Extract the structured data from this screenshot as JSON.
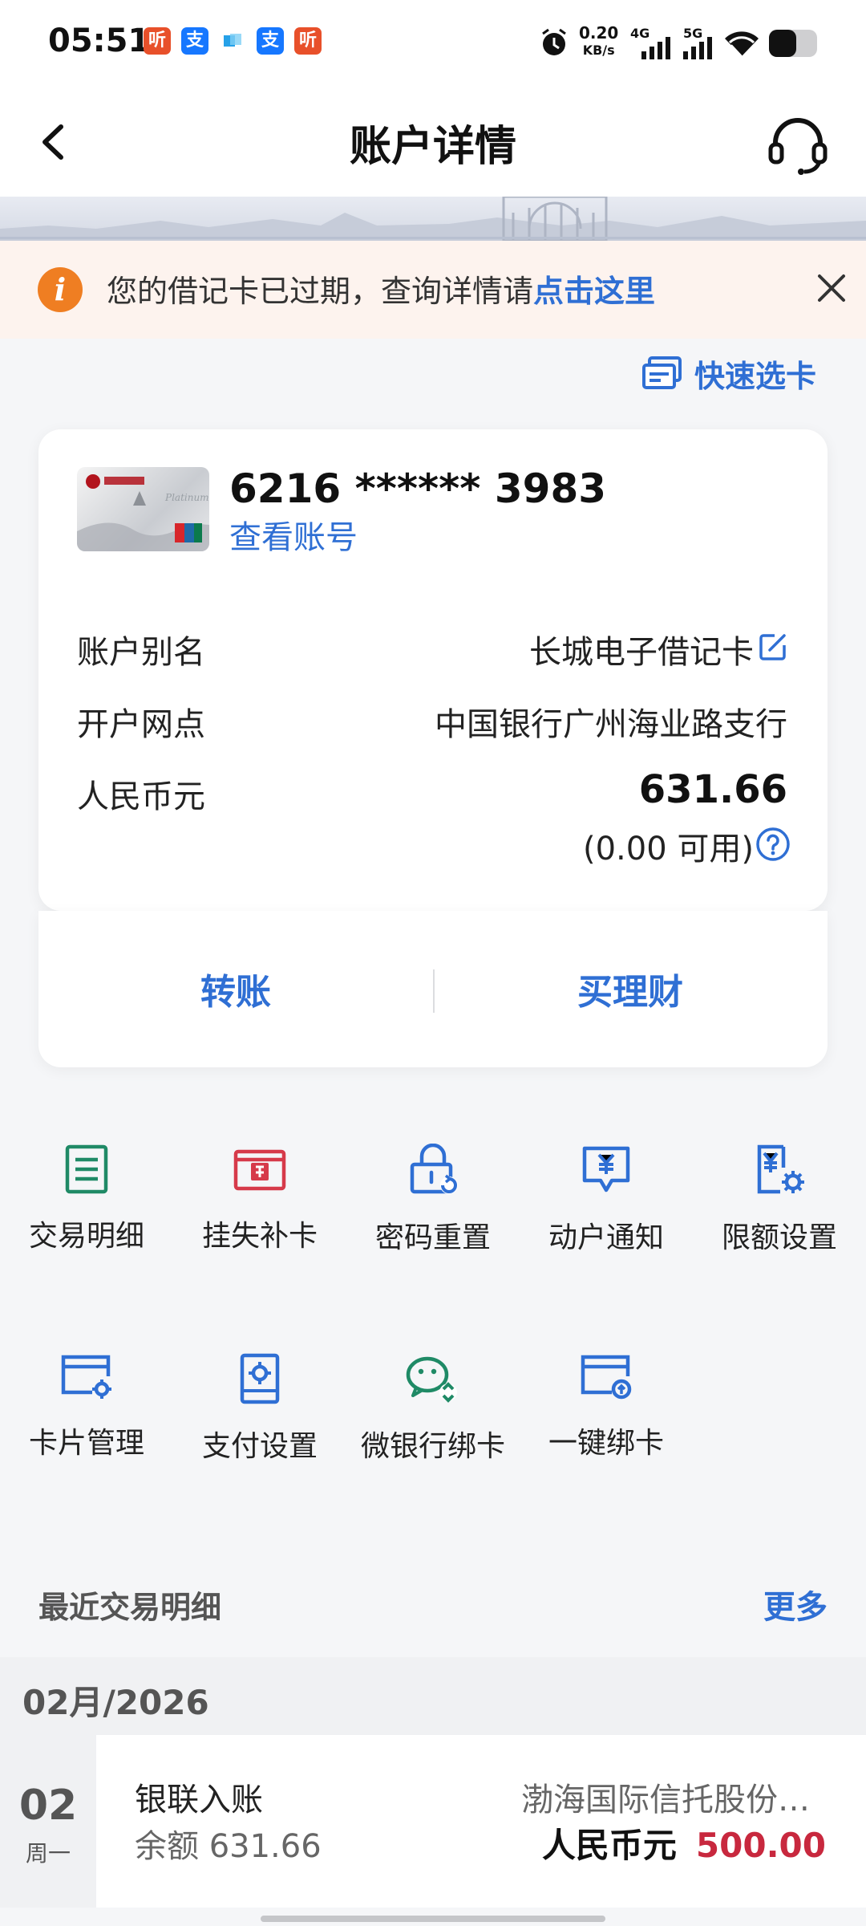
{
  "status_bar": {
    "time": "05:51",
    "apps": [
      {
        "glyph": "听",
        "color": "#e8502a"
      },
      {
        "glyph": "支",
        "color": "#1677ff"
      },
      {
        "glyph": "",
        "color": "#26a1e8"
      },
      {
        "glyph": "支",
        "color": "#1677ff"
      },
      {
        "glyph": "听",
        "color": "#e8502a"
      }
    ],
    "speed_value": "0.20",
    "speed_unit": "KB/s",
    "net_4g": "4G",
    "net_5g": "5G"
  },
  "header": {
    "title": "账户详情"
  },
  "notice": {
    "text": "您的借记卡已过期，查询详情请",
    "link": "点击这里",
    "icon_glyph": "i"
  },
  "quick_select": {
    "label": "快速选卡"
  },
  "card": {
    "number": "6216 ****** 3983",
    "view_account": "查看账号",
    "alias_label": "账户别名",
    "alias_value": "长城电子借记卡",
    "branch_label": "开户网点",
    "branch_value": "中国银行广州海业路支行",
    "currency_label": "人民币元",
    "balance": "631.66",
    "available": "(0.00 可用)"
  },
  "actions": {
    "transfer": "转账",
    "finance": "买理财"
  },
  "functions": [
    {
      "label": "交易明细",
      "icon": "list-icon"
    },
    {
      "label": "挂失补卡",
      "icon": "report-loss-icon"
    },
    {
      "label": "密码重置",
      "icon": "lock-reset-icon"
    },
    {
      "label": "动户通知",
      "icon": "yuan-notify-icon"
    },
    {
      "label": "限额设置",
      "icon": "yuan-settings-icon"
    },
    {
      "label": "卡片管理",
      "icon": "card-gear-icon"
    },
    {
      "label": "支付设置",
      "icon": "payment-settings-icon"
    },
    {
      "label": "微银行绑卡",
      "icon": "wechat-bind-icon"
    },
    {
      "label": "一键绑卡",
      "icon": "card-link-icon"
    }
  ],
  "recent": {
    "title": "最近交易明细",
    "more": "更多",
    "month": "02月/2026",
    "transactions": [
      {
        "day": "02",
        "weekday": "周一",
        "type": "银联入账",
        "balance": "余额  631.66",
        "counterparty": "渤海国际信托股份…",
        "currency": "人民币元",
        "amount": "500.00"
      }
    ]
  },
  "colors": {
    "accent_blue": "#2f6fd4",
    "notice_orange": "#ef7e22",
    "amount_red": "#c8283e",
    "icon_green": "#1f8a66",
    "icon_red": "#d63a4a"
  }
}
